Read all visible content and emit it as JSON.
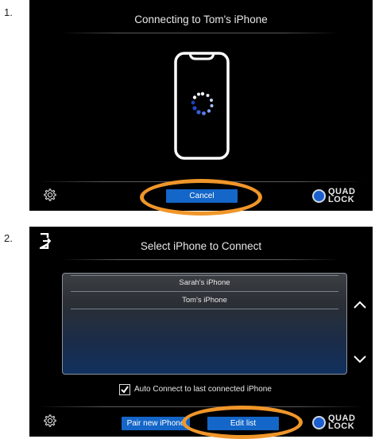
{
  "steps": [
    {
      "number": "1.",
      "title": "Connecting to Tom's iPhone",
      "cancel_label": "Cancel",
      "logo_text_line1": "QUAD",
      "logo_text_line2": "LOCK",
      "icons": [
        "phone-icon",
        "loading-spinner-icon",
        "gear-icon"
      ]
    },
    {
      "number": "2.",
      "title": "Select iPhone to Connect",
      "devices": [
        "Sarah's iPhone",
        "Tom's iPhone"
      ],
      "auto_connect_label": "Auto Connect to last connected iPhone",
      "auto_connect_checked": true,
      "pair_new_label": "Pair new iPhone",
      "edit_list_label": "Edit list",
      "logo_text_line1": "QUAD",
      "logo_text_line2": "LOCK",
      "icons": [
        "exit-icon",
        "chevron-up-icon",
        "chevron-down-icon",
        "checkmark-icon",
        "gear-icon"
      ]
    }
  ],
  "colors": {
    "screen_bg": "#000000",
    "button_blue": "#1466c8",
    "highlight_orange": "#f0962a",
    "logo_blue": "#1a5fd0"
  }
}
